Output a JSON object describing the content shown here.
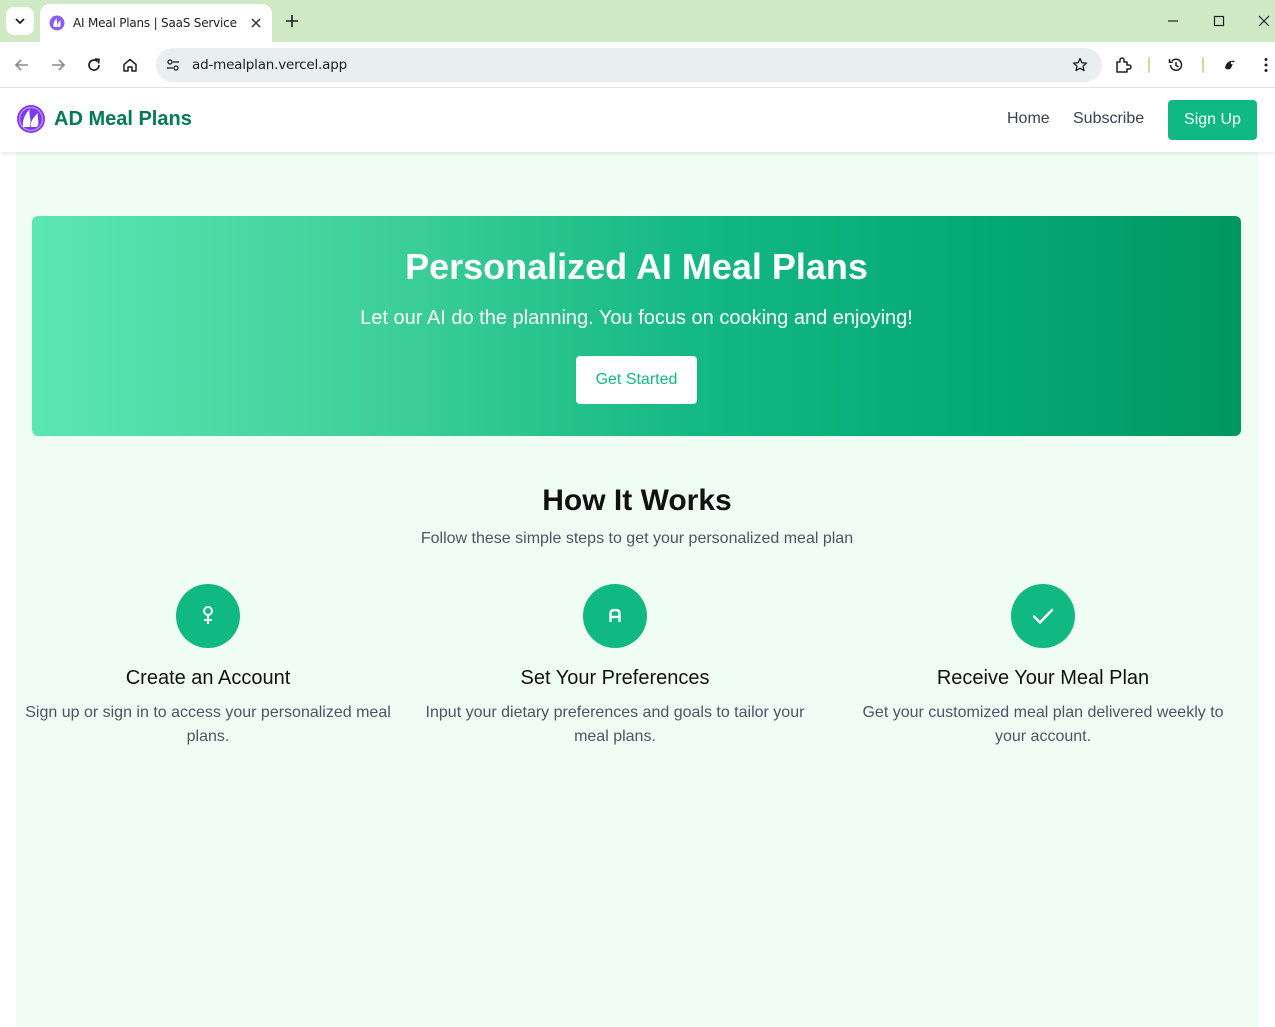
{
  "browser": {
    "tab_title": "AI Meal Plans | SaaS Service",
    "url": "ad-mealplan.vercel.app"
  },
  "header": {
    "brand": "AD Meal Plans",
    "nav": {
      "home": "Home",
      "subscribe": "Subscribe",
      "signup": "Sign Up"
    }
  },
  "hero": {
    "title": "Personalized AI Meal Plans",
    "subtitle": "Let our AI do the planning. You focus on cooking and enjoying!",
    "cta": "Get Started"
  },
  "how_it_works": {
    "title": "How It Works",
    "subtitle": "Follow these simple steps to get your personalized meal plan",
    "steps": [
      {
        "icon": "user-icon",
        "title": "Create an Account",
        "description": "Sign up or sign in to access your personalized meal plans."
      },
      {
        "icon": "preferences-icon",
        "title": "Set Your Preferences",
        "description": "Input your dietary preferences and goals to tailor your meal plans."
      },
      {
        "icon": "check-icon",
        "title": "Receive Your Meal Plan",
        "description": "Get your customized meal plan delivered weekly to your account."
      }
    ]
  },
  "colors": {
    "brand": "#047857",
    "accent": "#10b981",
    "page_bg": "#f0fdf4",
    "chrome_tabbar": "#cfe9c4"
  }
}
